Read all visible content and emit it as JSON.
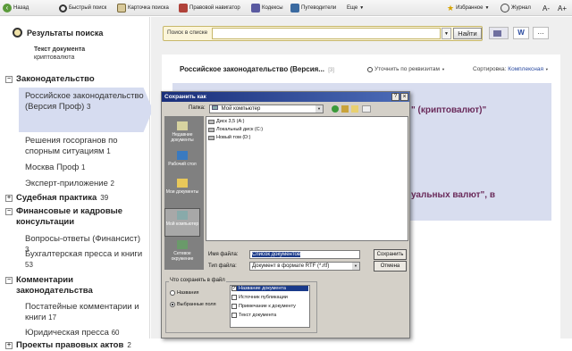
{
  "toolbar": {
    "back": "Назад",
    "quick_search": "Быстрый поиск",
    "search_card": "Карточка поиска",
    "legal_navigator": "Правовой навигатор",
    "codes": "Кодексы",
    "guides": "Путеводители",
    "more": "Еще",
    "favorites": "Избранное",
    "journal": "Журнал",
    "font_smaller": "A-",
    "font_larger": "A+"
  },
  "left_panel": {
    "title": "Результаты поиска",
    "subtitle_line1": "Текст документа",
    "subtitle_line2": "криптовалюта",
    "sections": [
      {
        "label": "Законодательство",
        "toggle": "−",
        "items": [
          {
            "label": "Российское законодательство (Версия Проф)",
            "count": "3"
          },
          {
            "label": "Решения госорганов по спорным ситуациям",
            "count": "1"
          },
          {
            "label": "Москва Проф",
            "count": "1"
          },
          {
            "label": "Эксперт-приложение",
            "count": "2"
          }
        ]
      },
      {
        "label": "Судебная практика",
        "toggle": "+",
        "count": "39"
      },
      {
        "label": "Финансовые и кадровые консультации",
        "toggle": "−",
        "items": [
          {
            "label": "Вопросы-ответы (Финансист)",
            "count": "3"
          },
          {
            "label": "Бухгалтерская пресса и книги",
            "count": "53"
          }
        ]
      },
      {
        "label": "Комментарии законодательства",
        "toggle": "−",
        "items": [
          {
            "label": "Постатейные комментарии и книги",
            "count": "17"
          },
          {
            "label": "Юридическая пресса",
            "count": "60"
          }
        ]
      },
      {
        "label": "Проекты правовых актов",
        "toggle": "+",
        "count": "2"
      }
    ]
  },
  "search_bar": {
    "prefix": "Поиск в списке",
    "value": "",
    "button": "Найти"
  },
  "document": {
    "header_title": "Российское законодательство (Версия...",
    "header_counter": "[3]",
    "refine_label": "Уточнить по реквизитам",
    "sort_label": "Сортировка:",
    "sort_value": "Комплексная",
    "result_snippet_1": "\" (криптовалют)\"",
    "result_snippet_2": "уальных валют\", в"
  },
  "save_dialog": {
    "title": "Сохранить как",
    "folder_label": "Папка:",
    "folder_value": "Мой компьютер",
    "places": [
      "Недавние документы",
      "Рабочий стол",
      "Мои документы",
      "Мой компьютер",
      "Сетевое окружение"
    ],
    "drives": [
      "Диск 3,5 (A:)",
      "Локальный диск (C:)",
      "Новый том (D:)"
    ],
    "filename_label": "Имя файла:",
    "filename_value": "Список документов",
    "filetype_label": "Тип файла:",
    "filetype_value": "Документ в формате RTF (*.rtf)",
    "save_button": "Сохранить",
    "cancel_button": "Отмена",
    "what_to_save_label": "Что сохранять в файл",
    "radio_names": "Названия",
    "radio_selected_fields": "Выбранные поля",
    "checkboxes": [
      {
        "label": "Название документа",
        "checked": true
      },
      {
        "label": "Источник публикации",
        "checked": false
      },
      {
        "label": "Примечание к документу",
        "checked": false
      },
      {
        "label": "Текст документа",
        "checked": false
      }
    ],
    "help_glyph": "?",
    "close_glyph": "×"
  }
}
